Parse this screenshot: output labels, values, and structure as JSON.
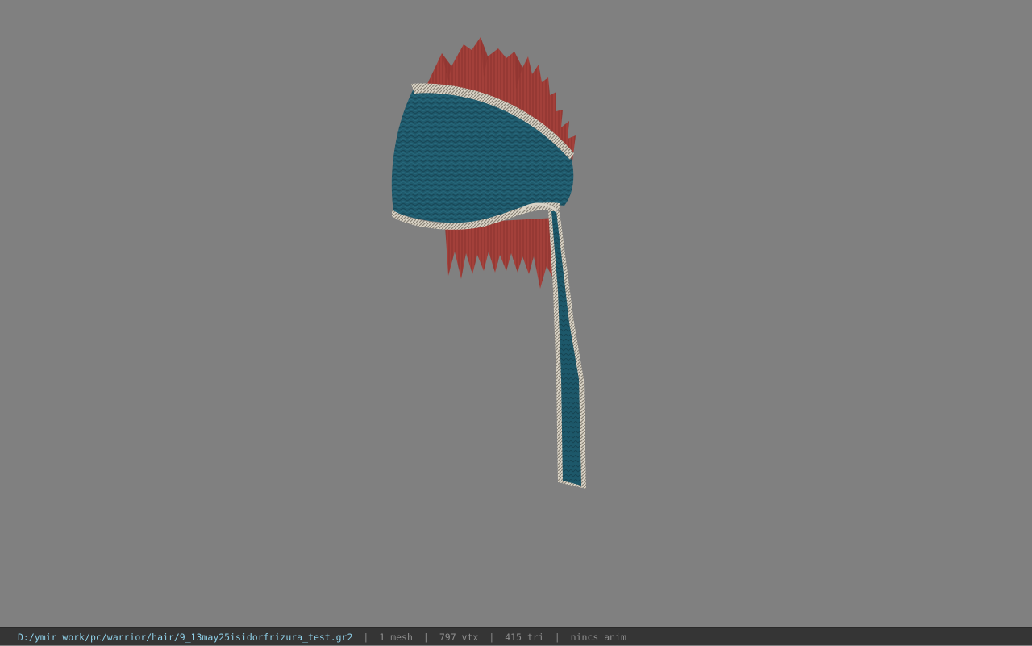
{
  "viewer": {
    "background_color": "#808080",
    "model": {
      "parts": [
        "hair-spikes-icon",
        "cap-icon",
        "trim-band-icon",
        "ribbon-tail-icon"
      ],
      "colors": {
        "cap": "#1f5a6c",
        "hair": "#a8423c",
        "trim": "#d8d2c4"
      }
    }
  },
  "status_bar": {
    "file_path": "D:/ymir work/pc/warrior/hair/9_13may25isidorfrizura_test.gr2",
    "separator": "|",
    "mesh": "1 mesh",
    "vertices": "797 vtx",
    "triangles": "415 tri",
    "animation": "nincs anim"
  }
}
